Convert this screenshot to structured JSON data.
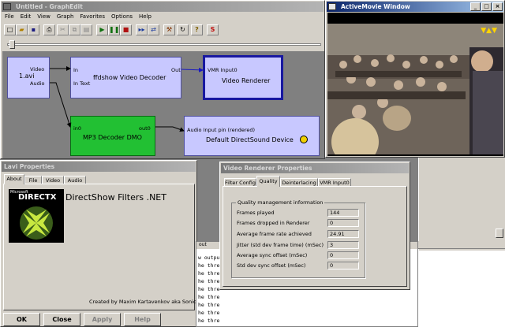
{
  "graphedit": {
    "title": "Untitled - GraphEdit",
    "menu": [
      "File",
      "Edit",
      "View",
      "Graph",
      "Favorites",
      "Options",
      "Help"
    ],
    "filters": {
      "source": {
        "name": "1.avi",
        "pins_out": [
          "Video",
          "Audio"
        ]
      },
      "video_decoder": {
        "name": "ffdshow Video Decoder",
        "pin_in": [
          "In",
          "In Text"
        ],
        "pin_out": "Out"
      },
      "video_renderer": {
        "name": "Video Renderer",
        "pin_in": "VMR Input0"
      },
      "audio_decoder": {
        "name": "MP3 Decoder DMO",
        "pin_in": "in0",
        "pin_out": "out0"
      },
      "audio_renderer": {
        "name": "Default DirectSound Device",
        "pin_in": "Audio Input pin (rendered)"
      }
    },
    "colors": {
      "filter_bg": "#c8c8ff",
      "selected_border": "#1818a0",
      "dmo_bg": "#22c033",
      "canvas": "#808080"
    }
  },
  "activemovie": {
    "title": "ActiveMovie Window"
  },
  "lavi": {
    "title": "Lavi Properties",
    "tabs": [
      "About",
      "File",
      "Video",
      "Audio"
    ],
    "logo_small": "Microsoft",
    "logo_text": "DIRECTX",
    "heading": "DirectShow Filters .NET",
    "credit": "Created by Maxim Kartavenkov aka Sonic",
    "buttons": {
      "ok": "OK",
      "close": "Close",
      "apply": "Apply",
      "help": "Help"
    }
  },
  "vmr": {
    "title": "Video Renderer Properties",
    "tabs": [
      "Filter Config",
      "Quality",
      "Deinterlacing",
      "VMR Input0"
    ],
    "group": "Quality management information",
    "rows": [
      {
        "label": "Frames played",
        "value": "144"
      },
      {
        "label": "Frames dropped in Renderer",
        "value": "0"
      },
      {
        "label": "Average frame rate achieved",
        "value": "24.91"
      },
      {
        "label": "Jitter (std dev frame time) (mSec)",
        "value": "3"
      },
      {
        "label": "Average sync offset (mSec)",
        "value": "0"
      },
      {
        "label": "Std dev sync offset (mSec)",
        "value": "0"
      }
    ]
  },
  "console": {
    "title": "out",
    "lines": [
      "w output",
      "he thre",
      "he thre",
      "he thre",
      "he thre",
      "he thre",
      "he thre",
      "he thre",
      "he thre"
    ]
  }
}
